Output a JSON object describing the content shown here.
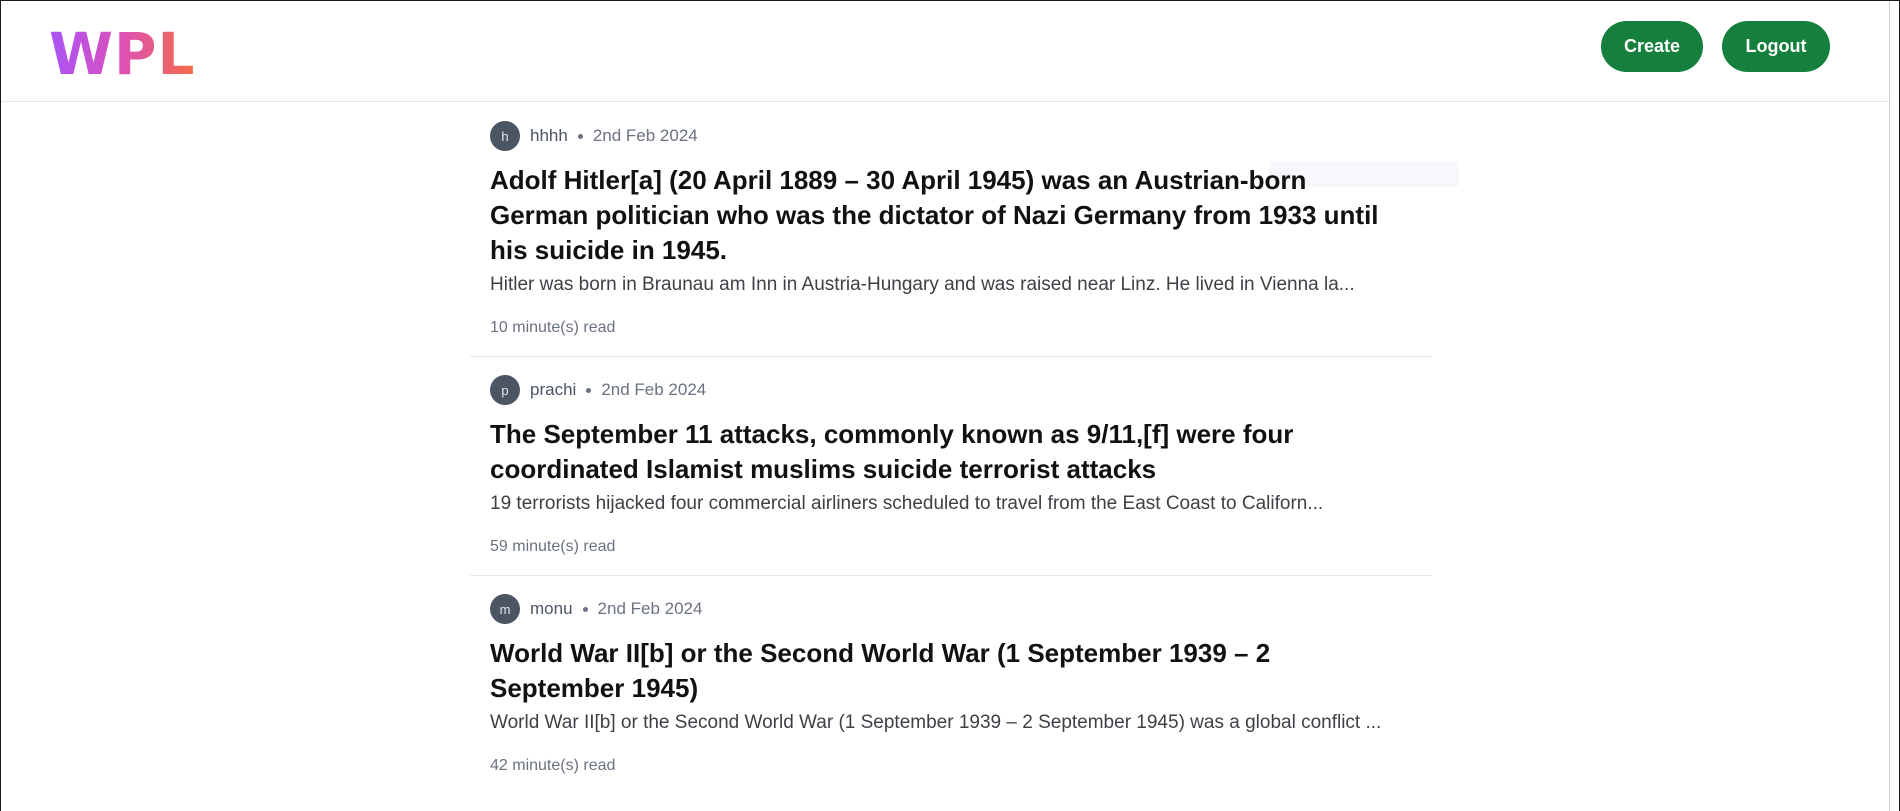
{
  "header": {
    "logo_text": "WPL",
    "create_label": "Create",
    "logout_label": "Logout"
  },
  "colors": {
    "accent_button": "#15803d",
    "logo_gradient_start": "#a855f7",
    "logo_gradient_end": "#f46b45"
  },
  "posts": [
    {
      "avatar_letter": "h",
      "author": "hhhh",
      "date": "2nd Feb 2024",
      "title": "Adolf Hitler[a] (20 April 1889 – 30 April 1945) was an Austrian-born German politician who was the dictator of Nazi Germany from 1933 until his suicide in 1945.",
      "excerpt": "Hitler was born in Braunau am Inn in Austria-Hungary and was raised near Linz. He lived in Vienna la...",
      "read_time": "10 minute(s) read"
    },
    {
      "avatar_letter": "p",
      "author": "prachi",
      "date": "2nd Feb 2024",
      "title": "The September 11 attacks, commonly known as 9/11,[f] were four coordinated Islamist muslims suicide terrorist attacks",
      "excerpt": "19 terrorists hijacked four commercial airliners scheduled to travel from the East Coast to Californ...",
      "read_time": "59 minute(s) read"
    },
    {
      "avatar_letter": "m",
      "author": "monu",
      "date": "2nd Feb 2024",
      "title": "World War II[b] or the Second World War (1 September 1939 – 2 September 1945)",
      "excerpt": "World War II[b] or the Second World War (1 September 1939 – 2 September 1945) was a global conflict ...",
      "read_time": "42 minute(s) read"
    }
  ]
}
